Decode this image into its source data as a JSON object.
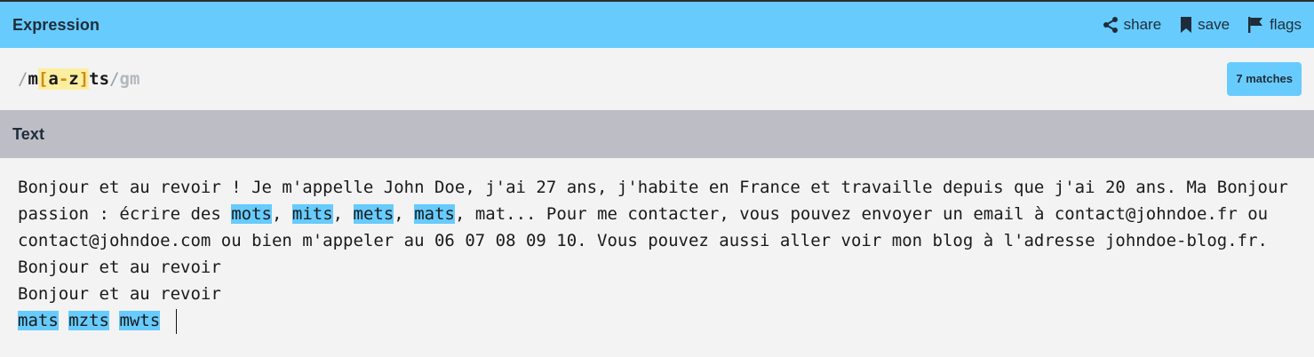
{
  "expression_section": {
    "title": "Expression",
    "actions": [
      {
        "label": "share",
        "icon": "share-icon"
      },
      {
        "label": "save",
        "icon": "bookmark-icon"
      },
      {
        "label": "flags",
        "icon": "flag-icon"
      }
    ]
  },
  "expression": {
    "open_delim": "/",
    "prefix": "m",
    "set_open": "[",
    "range_start": "a",
    "range_dash": "-",
    "range_end": "z",
    "set_close": "]",
    "suffix": "ts",
    "close_delim": "/",
    "flags": "gm"
  },
  "match_badge": "7 matches",
  "text_section": {
    "title": "Text"
  },
  "text": {
    "segments": [
      {
        "t": "Bonjour et au revoir ! Je m'appelle John Doe, j'ai 27 ans, j'habite en France et travaille depuis que j'ai 20 ans. Ma Bonjour passion : écrire des "
      },
      {
        "t": "mots",
        "m": true
      },
      {
        "t": ", "
      },
      {
        "t": "mits",
        "m": true
      },
      {
        "t": ", "
      },
      {
        "t": "mets",
        "m": true
      },
      {
        "t": ", "
      },
      {
        "t": "mats",
        "m": true
      },
      {
        "t": ", mat... Pour me contacter, vous pouvez envoyer un email à contact@johndoe.fr ou contact@johndoe.com ou bien m'appeler au 06 07 08 09 10. Vous pouvez aussi aller voir mon blog à l'adresse johndoe-blog.fr. Bonjour et au revoir\nBonjour et au revoir\n"
      },
      {
        "t": "mats",
        "m": true
      },
      {
        "t": " "
      },
      {
        "t": "mzts",
        "m": true
      },
      {
        "t": " "
      },
      {
        "t": "mwts",
        "m": true
      },
      {
        "t": " "
      }
    ]
  },
  "colors": {
    "header_bg": "#67cbfd",
    "text_header_bg": "#bdbdc6",
    "match_highlight": "#67cbfd",
    "char_set_bg": "#fbeea0",
    "char_set_bracket": "#d18a14"
  }
}
